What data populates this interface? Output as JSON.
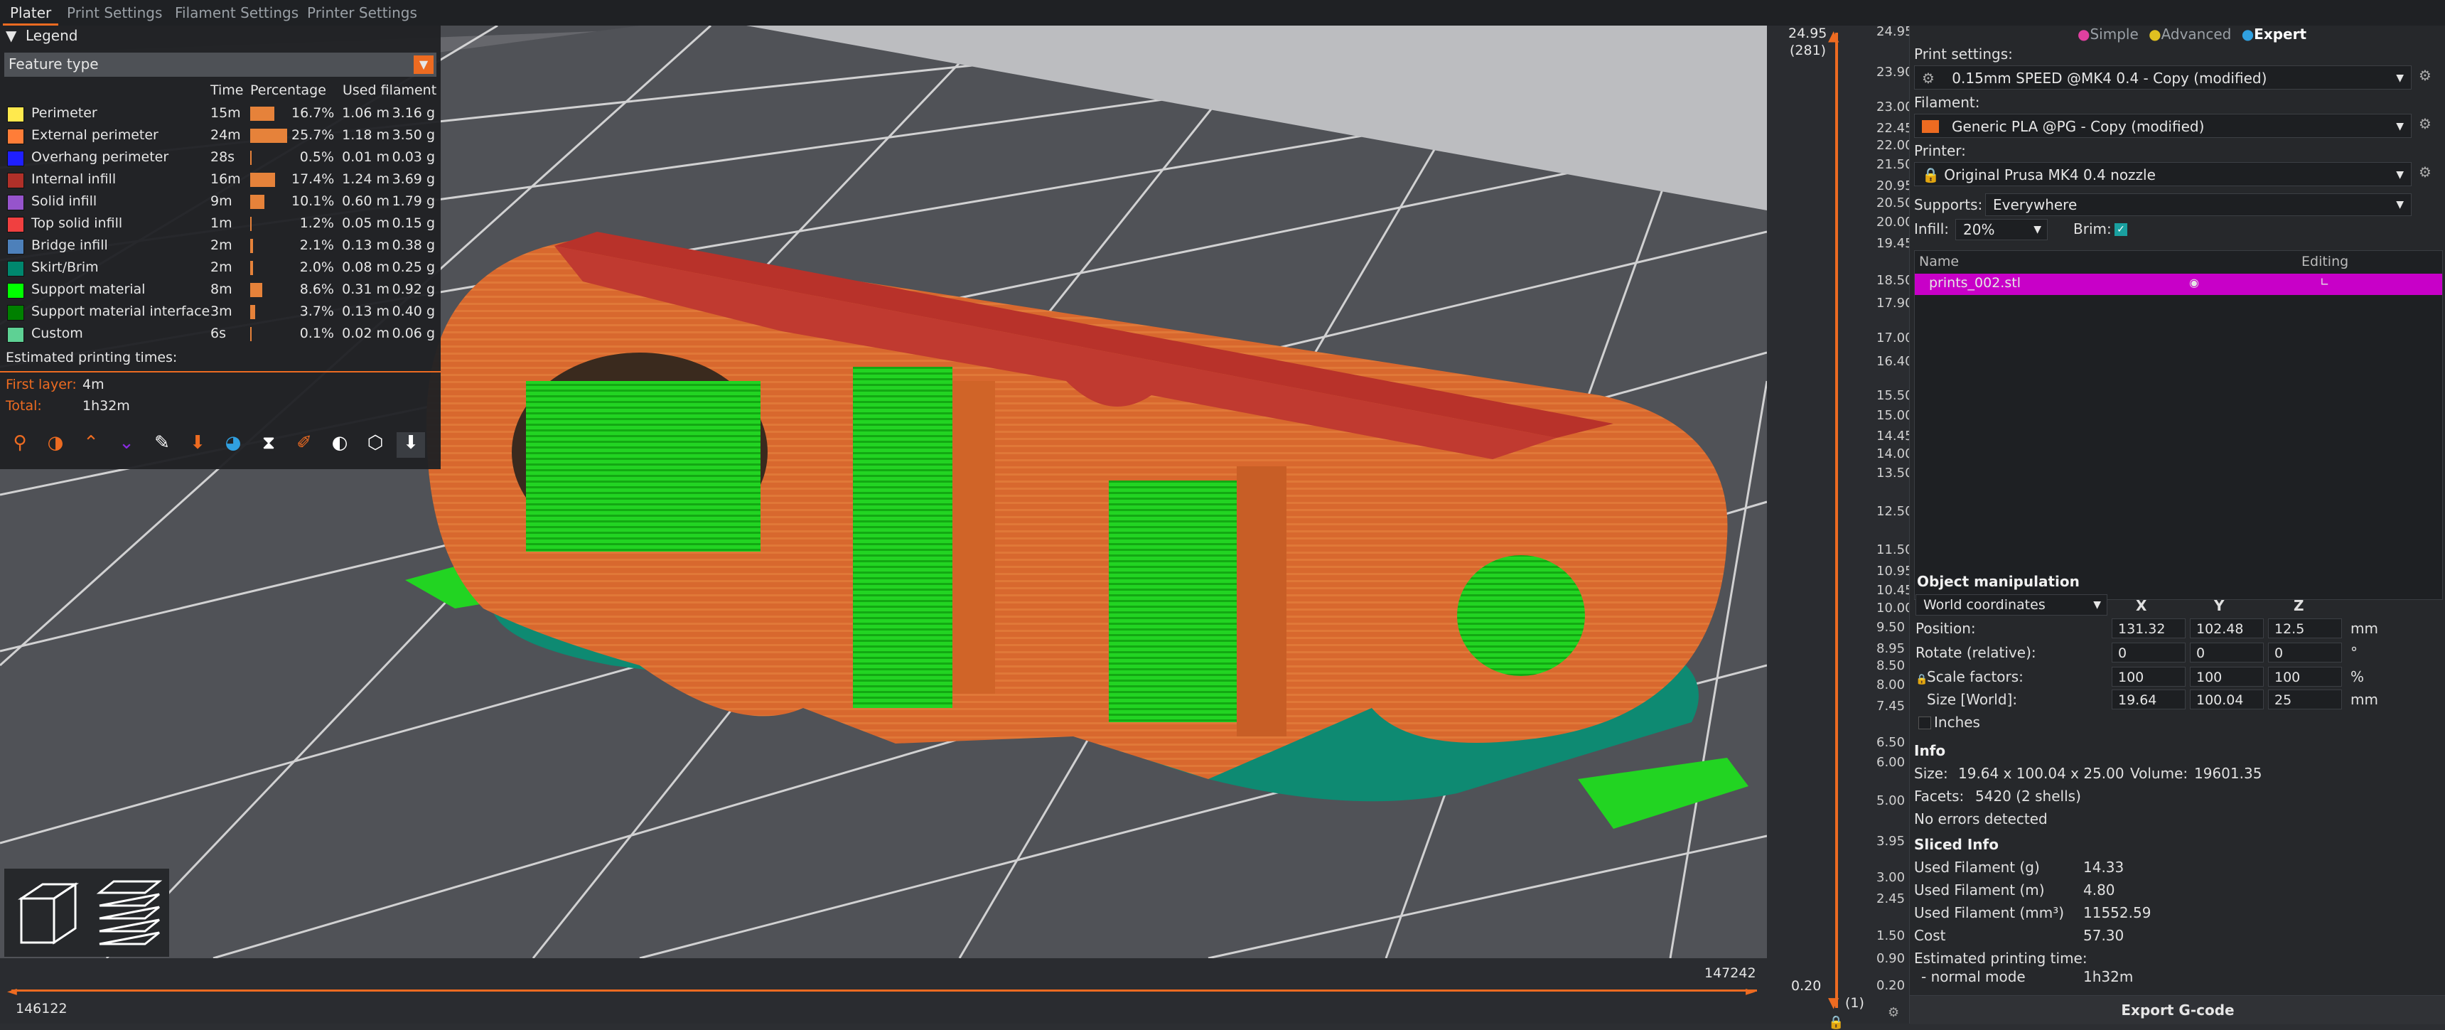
{
  "tabs": [
    "Plater",
    "Print Settings",
    "Filament Settings",
    "Printer Settings"
  ],
  "legend": {
    "title": "Legend",
    "view_type": "Feature type",
    "col_time": "Time",
    "col_pct": "Percentage",
    "col_used": "Used filament",
    "rows": [
      {
        "name": "Perimeter",
        "time": "15m",
        "pct": "16.7%",
        "pct_value": 16.7,
        "m": "1.06 m",
        "g": "3.16 g",
        "color": "#ffe94d"
      },
      {
        "name": "External perimeter",
        "time": "24m",
        "pct": "25.7%",
        "pct_value": 25.7,
        "m": "1.18 m",
        "g": "3.50 g",
        "color": "#ff7d38"
      },
      {
        "name": "Overhang perimeter",
        "time": "28s",
        "pct": "0.5%",
        "pct_value": 0.5,
        "m": "0.01 m",
        "g": "0.03 g",
        "color": "#1f1fff"
      },
      {
        "name": "Internal infill",
        "time": "16m",
        "pct": "17.4%",
        "pct_value": 17.4,
        "m": "1.24 m",
        "g": "3.69 g",
        "color": "#b03029"
      },
      {
        "name": "Solid infill",
        "time": "9m",
        "pct": "10.1%",
        "pct_value": 10.1,
        "m": "0.60 m",
        "g": "1.79 g",
        "color": "#9654cc"
      },
      {
        "name": "Top solid infill",
        "time": "1m",
        "pct": "1.2%",
        "pct_value": 1.2,
        "m": "0.05 m",
        "g": "0.15 g",
        "color": "#f04040"
      },
      {
        "name": "Bridge infill",
        "time": "2m",
        "pct": "2.1%",
        "pct_value": 2.1,
        "m": "0.13 m",
        "g": "0.38 g",
        "color": "#4d80ba"
      },
      {
        "name": "Skirt/Brim",
        "time": "2m",
        "pct": "2.0%",
        "pct_value": 2.0,
        "m": "0.08 m",
        "g": "0.25 g",
        "color": "#00876e"
      },
      {
        "name": "Support material",
        "time": "8m",
        "pct": "8.6%",
        "pct_value": 8.6,
        "m": "0.31 m",
        "g": "0.92 g",
        "color": "#00ff00"
      },
      {
        "name": "Support material interface",
        "time": "3m",
        "pct": "3.7%",
        "pct_value": 3.7,
        "m": "0.13 m",
        "g": "0.40 g",
        "color": "#008000"
      },
      {
        "name": "Custom",
        "time": "6s",
        "pct": "0.1%",
        "pct_value": 0.1,
        "m": "0.02 m",
        "g": "0.06 g",
        "color": "#5ed194"
      }
    ],
    "est_title": "Estimated printing times:",
    "first_layer_label": "First layer:",
    "first_layer_value": "4m",
    "total_label": "Total:",
    "total_value": "1h32m",
    "toolbar_icons": [
      "travel-icon",
      "wipe-icon",
      "retractions-icon",
      "deretractions-icon",
      "seams-icon",
      "tool-changes-icon",
      "color-changes-icon",
      "pause-icon",
      "custom-gcode-icon",
      "center-of-gravity-icon",
      "shells-icon",
      "tool-marker-icon"
    ]
  },
  "hslider": {
    "left_value": "146122",
    "right_value": "147242"
  },
  "vslider": {
    "top_value": "24.95",
    "top_layer": "(281)",
    "bottom_value": "0.20",
    "bottom_layer": "(1)",
    "ticks": [
      "24.95",
      "23.90",
      "23.00",
      "22.45",
      "22.00",
      "21.50",
      "20.95",
      "20.50",
      "20.00",
      "19.45",
      "18.50",
      "17.90",
      "17.00",
      "16.40",
      "15.50",
      "15.00",
      "14.45",
      "14.00",
      "13.50",
      "12.50",
      "11.50",
      "10.95",
      "10.45",
      "10.00",
      "9.50",
      "8.95",
      "8.50",
      "8.00",
      "7.45",
      "6.50",
      "6.00",
      "5.00",
      "3.95",
      "3.00",
      "2.45",
      "1.50",
      "0.90",
      "0.20"
    ]
  },
  "panel": {
    "modes": [
      "Simple",
      "Advanced",
      "Expert"
    ],
    "print_settings_label": "Print settings:",
    "print_settings_value": "0.15mm SPEED @MK4 0.4 - Copy (modified)",
    "filament_label": "Filament:",
    "filament_value": "Generic PLA @PG - Copy (modified)",
    "filament_color": "#ed6b21",
    "printer_label": "Printer:",
    "printer_value": "Original Prusa MK4 0.4 nozzle",
    "supports_label": "Supports:",
    "supports_value": "Everywhere",
    "infill_label": "Infill:",
    "infill_value": "20%",
    "brim_label": "Brim:",
    "brim_checked": true,
    "objects_col_name": "Name",
    "objects_col_editing": "Editing",
    "object_name": "prints_002.stl",
    "object_row_color": "#c800c8",
    "objman_title": "Object manipulation",
    "coords": "World coordinates",
    "axes": [
      "X",
      "Y",
      "Z"
    ],
    "position_label": "Position:",
    "position": [
      "131.32",
      "102.48",
      "12.5"
    ],
    "position_unit": "mm",
    "rotate_label": "Rotate (relative):",
    "rotate": [
      "0",
      "0",
      "0"
    ],
    "rotate_unit": "°",
    "scale_label": "Scale factors:",
    "scale": [
      "100",
      "100",
      "100"
    ],
    "scale_unit": "%",
    "size_label": "Size [World]:",
    "size": [
      "19.64",
      "100.04",
      "25"
    ],
    "size_unit": "mm",
    "inches_label": "Inches",
    "info_title": "Info",
    "info_size_label": "Size:",
    "info_size": "19.64 x 100.04 x 25.00",
    "info_volume_label": "Volume:",
    "info_volume": "19601.35",
    "info_facets_label": "Facets:",
    "info_facets": "5420 (2 shells)",
    "info_errors": "No errors detected",
    "sliced_title": "Sliced Info",
    "sliced": [
      {
        "label": "Used Filament (g)",
        "value": "14.33"
      },
      {
        "label": "Used Filament (m)",
        "value": "4.80"
      },
      {
        "label": "Used Filament (mm³)",
        "value": "11552.59"
      },
      {
        "label": "Cost",
        "value": "57.30"
      }
    ],
    "est_label": "Estimated printing time:",
    "normal_mode_label": "- normal mode",
    "normal_mode_value": "1h32m",
    "export_label": "Export G-code"
  }
}
